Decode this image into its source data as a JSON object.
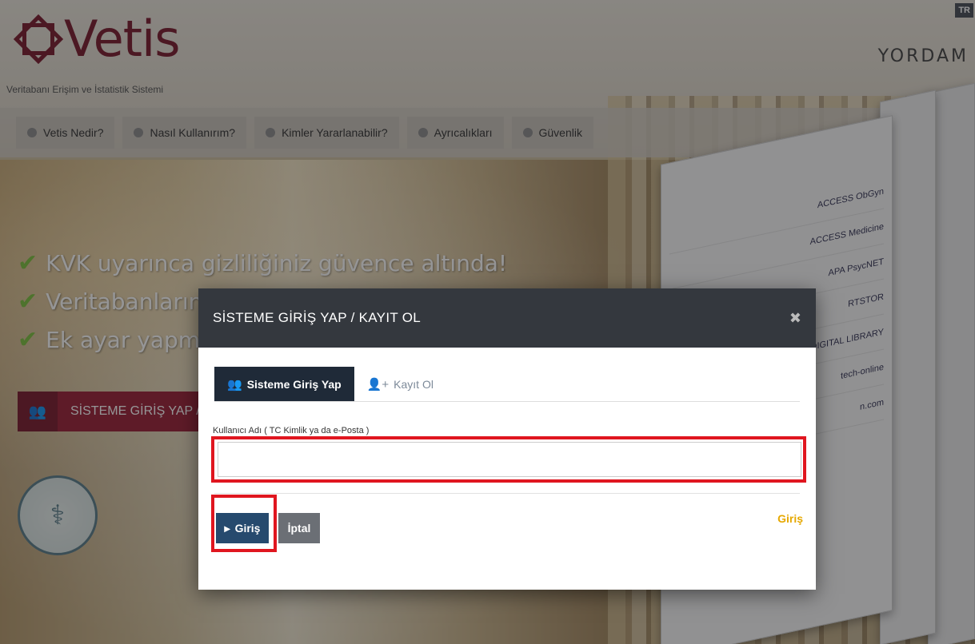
{
  "header": {
    "logo_text": "Vetis",
    "subtitle": "Veritabanı Erişim ve İstatistik Sistemi",
    "brand_right": "YORDAM",
    "lang": "TR"
  },
  "menu": [
    {
      "label": "Vetis Nedir?"
    },
    {
      "label": "Nasıl Kullanırım?"
    },
    {
      "label": "Kimler Yararlanabilir?"
    },
    {
      "label": "Ayrıcalıkları"
    },
    {
      "label": "Güvenlik"
    }
  ],
  "features": [
    {
      "text": "KVK uyarınca gizliliğiniz güvence altında!"
    },
    {
      "text": "Veritabanlarına"
    },
    {
      "text": "Ek ayar yapma"
    }
  ],
  "login_button": {
    "label": "SİSTEME GİRİŞ YAP /"
  },
  "modal": {
    "title": "SİSTEME GİRİŞ YAP / KAYIT OL",
    "tabs": [
      {
        "label": "Sisteme Giriş Yap",
        "active": true
      },
      {
        "label": "Kayıt Ol",
        "active": false
      }
    ],
    "field_label": "Kullanıcı Adı ( TC Kimlik ya da e-Posta )",
    "field_value": "",
    "submit_label": "Giriş",
    "cancel_label": "İptal",
    "link_label": "Giriş"
  },
  "panes": {
    "rows": [
      "ACCESS ObGyn",
      "ACCESS Medicine",
      "APA PsycNET",
      "RTSTOR",
      "DIGITAL LIBRARY",
      "tech-online",
      "n.com"
    ]
  },
  "colors": {
    "brand": "#7a1c2e",
    "modal_header": "#34383e",
    "primary_button": "#264a6e",
    "highlight": "#e0161f",
    "link": "#e6a800"
  }
}
